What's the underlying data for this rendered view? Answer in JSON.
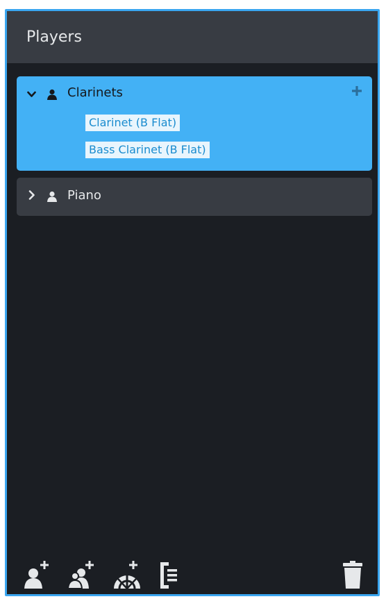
{
  "panel": {
    "title": "Players"
  },
  "players": [
    {
      "name": "Clarinets",
      "expanded": true,
      "selected": true,
      "expand_icon": "chevron-down-icon",
      "person_icon": "person-icon",
      "instruments": [
        "Clarinet (B Flat)",
        "Bass Clarinet (B Flat)"
      ],
      "add_icon": "plus-icon"
    },
    {
      "name": "Piano",
      "expanded": false,
      "selected": false,
      "expand_icon": "chevron-right-icon",
      "person_icon": "person-icon"
    }
  ],
  "toolbar": {
    "buttons": [
      "add-solo-player-icon",
      "add-section-player-icon",
      "add-ensemble-icon",
      "add-divisi-icon",
      "trash-icon"
    ]
  },
  "colors": {
    "accent": "#43b1f5",
    "border": "#3aa6f0",
    "panel_bg": "#1b1e23",
    "header_bg": "#383c43",
    "instrument_text": "#1a8ccf"
  }
}
